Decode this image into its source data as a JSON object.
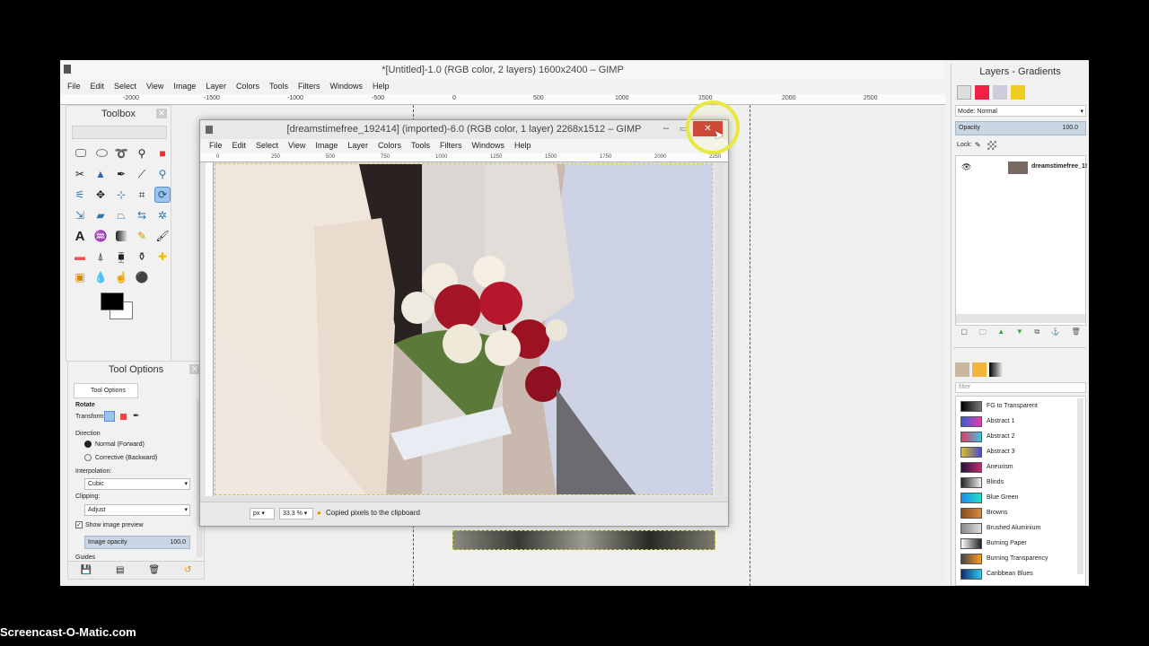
{
  "main_window": {
    "title": "*[Untitled]-1.0 (RGB color, 2 layers) 1600x2400 – GIMP",
    "menu": [
      "File",
      "Edit",
      "Select",
      "View",
      "Image",
      "Layer",
      "Colors",
      "Tools",
      "Filters",
      "Windows",
      "Help"
    ],
    "ruler_ticks": [
      "-2000",
      "-1500",
      "-1000",
      "-500",
      "0",
      "500",
      "1000",
      "1500",
      "2000",
      "2500"
    ]
  },
  "toolbox": {
    "title": "Toolbox"
  },
  "tool_options": {
    "title": "Tool Options",
    "tab": "Tool Options",
    "tool_name": "Rotate",
    "transform_label": "Transform:",
    "direction_label": "Direction",
    "direction_normal": "Normal (Forward)",
    "direction_corrective": "Corrective (Backward)",
    "interpolation_label": "Interpolation:",
    "interpolation_value": "Cubic",
    "clipping_label": "Clipping:",
    "clipping_value": "Adjust",
    "preview_label": "Show image preview",
    "opacity_label": "Image opacity",
    "opacity_value": "100.0",
    "guides_label": "Guides"
  },
  "image_window": {
    "title": "[dreamstimefree_192414] (imported)-6.0 (RGB color, 1 layer) 2268x1512 – GIMP",
    "close": "✕",
    "menu": [
      "File",
      "Edit",
      "Select",
      "View",
      "Image",
      "Layer",
      "Colors",
      "Tools",
      "Filters",
      "Windows",
      "Help"
    ],
    "ruler_ticks": [
      "0",
      "250",
      "500",
      "750",
      "1000",
      "1250",
      "1500",
      "1750",
      "2000",
      "2250"
    ],
    "unit": "px",
    "zoom": "33.3 %",
    "status": "Copied pixels to the clipboard"
  },
  "layers_panel": {
    "title": "Layers - Gradients",
    "mode_label": "Mode:",
    "mode_value": "Normal",
    "opacity_label": "Opacity",
    "opacity_value": "100.0",
    "lock_label": "Lock:",
    "layer_name": "dreamstimefree_1!"
  },
  "gradients_panel": {
    "filter_placeholder": "filter",
    "items": [
      {
        "name": "FG to Transparent",
        "colors": [
          "#000000",
          "#777777"
        ]
      },
      {
        "name": "Abstract 1",
        "colors": [
          "#3a5bd9",
          "#e23ea0"
        ]
      },
      {
        "name": "Abstract 2",
        "colors": [
          "#e23a6a",
          "#3ac6e0"
        ]
      },
      {
        "name": "Abstract 3",
        "colors": [
          "#d8c21e",
          "#4b4bd0"
        ]
      },
      {
        "name": "Aneurism",
        "colors": [
          "#26103e",
          "#c02d6e"
        ]
      },
      {
        "name": "Blinds",
        "colors": [
          "#222222",
          "#eeeeee"
        ]
      },
      {
        "name": "Blue Green",
        "colors": [
          "#1e8af0",
          "#1ee0c8"
        ]
      },
      {
        "name": "Browns",
        "colors": [
          "#8a4b1e",
          "#d58a3e"
        ]
      },
      {
        "name": "Brushed Aluminium",
        "colors": [
          "#888888",
          "#dddddd"
        ]
      },
      {
        "name": "Burning Paper",
        "colors": [
          "#ffffff",
          "#222222"
        ]
      },
      {
        "name": "Burning Transparency",
        "colors": [
          "#444444",
          "#ff9a1e"
        ]
      },
      {
        "name": "Caribbean Blues",
        "colors": [
          "#0a2e6e",
          "#2ec8ee"
        ]
      }
    ]
  },
  "screencast_label": "Screencast-O-Matic.com",
  "colors": {
    "close_red": "#c8322d",
    "highlight": "#e8e840"
  }
}
